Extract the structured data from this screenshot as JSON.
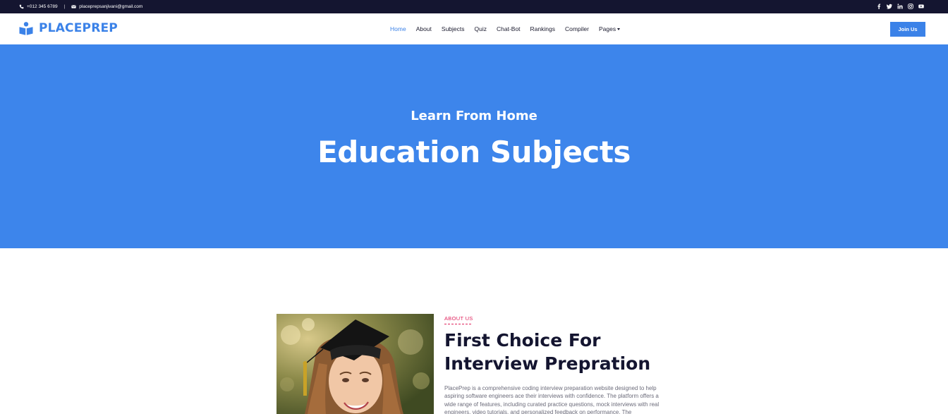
{
  "topbar": {
    "phone": "+012 345 6789",
    "separator": "|",
    "email": "placeprepsanjivani@gmail.com",
    "social": [
      "facebook-icon",
      "twitter-icon",
      "linkedin-icon",
      "instagram-icon",
      "youtube-icon"
    ]
  },
  "navbar": {
    "logo": "PLACEPREP",
    "items": [
      {
        "label": "Home",
        "active": true
      },
      {
        "label": "About"
      },
      {
        "label": "Subjects"
      },
      {
        "label": "Quiz"
      },
      {
        "label": "Chat-Bot"
      },
      {
        "label": "Rankings"
      },
      {
        "label": "Compiler"
      },
      {
        "label": "Pages"
      }
    ],
    "join_label": "Join Us"
  },
  "hero": {
    "subtitle": "Learn From Home",
    "title": "Education Subjects"
  },
  "about": {
    "label": "ABOUT US",
    "title": "First Choice For Interview Prepration",
    "text": "PlacePrep is a comprehensive coding interview preparation website designed to help aspiring software engineers ace their interviews with confidence. The platform offers a wide range of features, including curated practice questions, mock interviews with real engineers, video tutorials, and personalized feedback on performance. The"
  },
  "colors": {
    "accent": "#3b82e8",
    "hero_bg": "#3d85eb",
    "topbar_bg": "#141530",
    "label_red": "#e0245e"
  }
}
